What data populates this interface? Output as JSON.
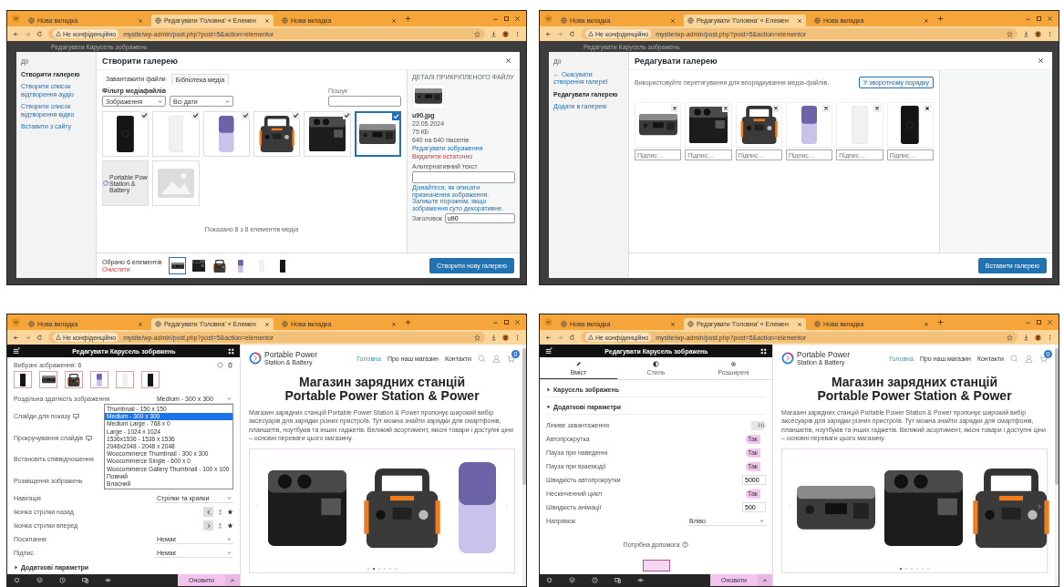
{
  "screens": [
    {
      "kind": "create-gallery",
      "browser": {
        "tabs": [
          {
            "title": "Нова вкладка",
            "selected": false
          },
          {
            "title": "Редагувати 'Головна' « Елемен",
            "selected": true
          },
          {
            "title": "Нова вкладка",
            "selected": false
          }
        ],
        "security": "Не конфіденційно",
        "url": "mysite/wp-admin/post.php?post=5&action=elementor"
      },
      "backdrop_title": "Редагувати Карусель зображень",
      "modal": {
        "menu_heading": "Дії",
        "menu": [
          {
            "label": "Створити галерею",
            "selected": true
          },
          {
            "label": "Створити список відтворення аудіо",
            "selected": false
          },
          {
            "label": "Створити список відтворення відео",
            "selected": false
          },
          {
            "label": "Вставити з сайту",
            "selected": false
          }
        ],
        "title": "Створити галерею",
        "tabs": [
          {
            "label": "Завантажити файли",
            "selected": false
          },
          {
            "label": "Бібліотека медіа",
            "selected": true
          }
        ],
        "filter_label": "Фільтр медіафайлів",
        "filters": [
          "Зображення",
          "Всі дати"
        ],
        "search_label": "Пошук",
        "items": [
          {
            "kind": "powerbank-black",
            "checked": true,
            "selected": false
          },
          {
            "kind": "powerbank-white",
            "checked": true,
            "selected": false
          },
          {
            "kind": "powerbank-purple",
            "checked": true,
            "selected": false
          },
          {
            "kind": "station-orange",
            "checked": true,
            "selected": false
          },
          {
            "kind": "station-black",
            "checked": true,
            "selected": false
          },
          {
            "kind": "station-gray",
            "checked": true,
            "selected": true
          },
          {
            "kind": "logo",
            "title": "Portable Pow",
            "subtitle": "Station & Battery",
            "checked": false,
            "selected": false
          },
          {
            "kind": "placeholder",
            "checked": false,
            "selected": false
          }
        ],
        "count_text": "Показано 8 з 8 елементів медіа",
        "details": {
          "heading": "ДЕТАЛІ ПРИКРІПЛЕНОГО ФАЙЛУ",
          "image": {
            "kind": "station-gray"
          },
          "filename": "u90.jpg",
          "date": "22.05.2024",
          "size": "75 КБ",
          "dimensions": "640 на 640 пікселів",
          "edit_link": "Редагувати зображення",
          "delete_link": "Видалити остаточно",
          "alt_label": "Альтернативний текст",
          "alt_help": "Дізнайтеся, як описати призначення зображення. Залиште порожнім, якщо зображення суто декоративне.",
          "title_label": "Заголовок",
          "title_value": "u90"
        },
        "selection": {
          "label": "Обрано 6 елементів",
          "clear": "Очистити",
          "thumbs": [
            {
              "kind": "station-gray",
              "selected": true
            },
            {
              "kind": "station-black",
              "selected": false
            },
            {
              "kind": "station-orange",
              "selected": false
            },
            {
              "kind": "powerbank-purple",
              "selected": false
            },
            {
              "kind": "powerbank-white",
              "selected": false
            },
            {
              "kind": "powerbank-black",
              "selected": false
            }
          ]
        },
        "primary_button": "Створити нову галерею"
      }
    },
    {
      "kind": "edit-gallery",
      "browser": {
        "tabs": [
          {
            "title": "Нова вкладка",
            "selected": false
          },
          {
            "title": "Редагувати 'Головна' « Елемен",
            "selected": true
          },
          {
            "title": "Нова вкладка",
            "selected": false
          }
        ],
        "security": "Не конфіденційно",
        "url": "mysite/wp-admin/post.php?post=5&action=elementor"
      },
      "backdrop_title": "Редагувати Карусель зображень",
      "modal": {
        "menu_heading": "Дії",
        "menu": [
          {
            "label": "← Скасувати створення галереї",
            "selected": false
          },
          {
            "label": "Редагувати галерею",
            "selected": true
          },
          {
            "label": "Додати в галерею",
            "selected": false
          }
        ],
        "title": "Редагувати галерею",
        "hint": "Використовуйте перетягування для впорядкування медіа-файлів.",
        "reverse_button": "У зворотному порядку",
        "items": [
          {
            "kind": "station-gray",
            "caption_placeholder": "Підпис…"
          },
          {
            "kind": "station-black",
            "caption_placeholder": "Підпис…"
          },
          {
            "kind": "station-orange",
            "caption_placeholder": "Підпис…"
          },
          {
            "kind": "powerbank-purple",
            "caption_placeholder": "Підпис…"
          },
          {
            "kind": "powerbank-white",
            "caption_placeholder": "Підпис…"
          },
          {
            "kind": "powerbank-black",
            "caption_placeholder": "Підпис…"
          }
        ],
        "primary_button": "Вставити галерею"
      }
    },
    {
      "kind": "editor",
      "browser": {
        "tabs": [
          {
            "title": "Нова вкладка",
            "selected": false
          },
          {
            "title": "Редагувати 'Головна' « Елемен",
            "selected": true
          },
          {
            "title": "Нова вкладка",
            "selected": false
          }
        ],
        "security": "Не конфіденційно",
        "url": "mysite/wp-admin/post.php?post=5&action=elementor"
      },
      "editor": {
        "title": "Редагувати Карусель зображень",
        "blocks": [
          {
            "kind": "gallery",
            "label": "Вибрані зображення: 6",
            "thumbs": [
              {
                "kind": "powerbank-black"
              },
              {
                "kind": "station-gray"
              },
              {
                "kind": "station-orange"
              },
              {
                "kind": "powerbank-purple"
              },
              {
                "kind": "powerbank-white"
              },
              {
                "kind": "powerbank-black"
              }
            ]
          },
          {
            "kind": "rows",
            "rows": [
              {
                "kind": "select",
                "label": "Роздільна здатність зображення",
                "value": "Medium - 300 x 300",
                "options": [
                  {
                    "label": "Thumbnail - 150 x 150",
                    "selected": false
                  },
                  {
                    "label": "Medium - 300 x 300",
                    "selected": true
                  },
                  {
                    "label": "Medium Large - 768 x 0",
                    "selected": false
                  },
                  {
                    "label": "Large - 1024 x 1024",
                    "selected": false
                  },
                  {
                    "label": "1536x1536 - 1536 x 1536",
                    "selected": false
                  },
                  {
                    "label": "2048x2048 - 2048 x 2048",
                    "selected": false
                  },
                  {
                    "label": "Woocommerce Thumbnail - 300 x 300",
                    "selected": false
                  },
                  {
                    "label": "Woocommerce Single - 600 x 0",
                    "selected": false
                  },
                  {
                    "label": "Woocommerce Gallery Thumbnail - 100 x 100",
                    "selected": false
                  },
                  {
                    "label": "Повний",
                    "selected": false
                  },
                  {
                    "label": "Власний",
                    "selected": false
                  }
                ]
              },
              {
                "kind": "device",
                "label": "Слайди для показу"
              },
              {
                "kind": "device",
                "label": "Прокручування слайдів"
              },
              {
                "kind": "text",
                "label": "Встановіть співвідношення"
              },
              {
                "kind": "text",
                "label": "Розміщення зображень"
              },
              {
                "kind": "select",
                "label": "Навігація",
                "value": "Стрілки та крапки"
              },
              {
                "kind": "arrow-left",
                "label": "Іконка стрілки назад"
              },
              {
                "kind": "arrow-right",
                "label": "Іконка стрілки вперед"
              },
              {
                "kind": "select",
                "label": "Посилання",
                "value": "Немає"
              },
              {
                "kind": "select",
                "label": "Підпис",
                "value": "Немає"
              }
            ]
          },
          {
            "kind": "section",
            "label": "Додаткові параметри",
            "expanded": false
          }
        ],
        "update_button": "Оновити"
      },
      "site": {
        "logo_title": "Portable Power",
        "logo_subtitle": "Station & Battery",
        "nav": [
          {
            "label": "Головна",
            "selected": true
          },
          {
            "label": "Про наш магазин",
            "selected": false
          },
          {
            "label": "Контакти",
            "selected": false
          }
        ],
        "cart_count": "0",
        "heading": [
          "Магазин зарядних станцій",
          "Portable Power Station & Power"
        ],
        "paragraph": "Магазин зарядних станцій Portable Power Station & Power пропонує широкий вибір аксесуарів для зарядки різних пристроїв. Тут можна знайти зарядки для смартфонів, планшетів, ноутбуків та інших гаджетів. Великий асортимент, якісні товари і доступні ціни – основні переваги цього магазину.",
        "slides": [
          {
            "kind": "station-black"
          },
          {
            "kind": "station-orange"
          },
          {
            "kind": "powerbank-purple"
          }
        ],
        "dots": [
          {
            "selected": false
          },
          {
            "selected": true
          },
          {
            "selected": false
          },
          {
            "selected": false
          },
          {
            "selected": false
          },
          {
            "selected": false
          }
        ]
      }
    },
    {
      "kind": "editor",
      "browser": {
        "tabs": [
          {
            "title": "Нова вкладка",
            "selected": false
          },
          {
            "title": "Редагувати 'Головна' « Елемен",
            "selected": true
          },
          {
            "title": "Нова вкладка",
            "selected": false
          }
        ],
        "security": "Не конфіденційно",
        "url": "mysite/wp-admin/post.php?post=5&action=elementor"
      },
      "editor": {
        "title": "Редагувати Карусель зображень",
        "blocks": [
          {
            "kind": "tabs",
            "tabs": [
              {
                "label": "Вміст",
                "selected": true
              },
              {
                "label": "Стиль",
                "selected": false
              },
              {
                "label": "Розширені",
                "selected": false
              }
            ]
          },
          {
            "kind": "section",
            "label": "Карусель зображень",
            "expanded": false
          },
          {
            "kind": "section",
            "label": "Додаткові параметри",
            "expanded": true
          },
          {
            "kind": "rows",
            "rows": [
              {
                "kind": "switch",
                "label": "Ліниве завантаження",
                "on": false,
                "text": "Ні"
              },
              {
                "kind": "switch",
                "label": "Автопрокрутка",
                "on": true,
                "text": "Так"
              },
              {
                "kind": "switch",
                "label": "Пауза при наведенні",
                "on": true,
                "text": "Так"
              },
              {
                "kind": "switch",
                "label": "Пауза при взаємодії",
                "on": true,
                "text": "Так"
              },
              {
                "kind": "number",
                "label": "Швидкість автопрокрутки",
                "value": "5000"
              },
              {
                "kind": "switch",
                "label": "Нескінченний цикл",
                "on": true,
                "text": "Так"
              },
              {
                "kind": "number",
                "label": "Швидкість анімації",
                "value": "500"
              },
              {
                "kind": "select",
                "label": "Напрямок",
                "value": "Вліво"
              }
            ]
          },
          {
            "kind": "help",
            "label": "Потрібна допомога"
          },
          {
            "kind": "sticker"
          }
        ],
        "update_button": "Оновити"
      },
      "site": {
        "logo_title": "Portable Power",
        "logo_subtitle": "Station & Battery",
        "nav": [
          {
            "label": "Головна",
            "selected": true
          },
          {
            "label": "Про наш магазин",
            "selected": false
          },
          {
            "label": "Контакти",
            "selected": false
          }
        ],
        "cart_count": "0",
        "heading": [
          "Магазин зарядних станцій",
          "Portable Power Station & Power"
        ],
        "paragraph": "Магазин зарядних станцій Portable Power Station & Power пропонує широкий вибір аксесуарів для зарядки різних пристроїв. Тут можна знайти зарядки для смартфонів, планшетів, ноутбуків та інших гаджетів. Великий асортимент, якісні товари і доступні ціни – основні переваги цього магазину.",
        "slides": [
          {
            "kind": "station-gray"
          },
          {
            "kind": "station-black"
          },
          {
            "kind": "station-orange"
          }
        ],
        "dots": [
          {
            "selected": true
          },
          {
            "selected": false
          },
          {
            "selected": false
          },
          {
            "selected": false
          },
          {
            "selected": false
          },
          {
            "selected": false
          }
        ]
      }
    }
  ]
}
